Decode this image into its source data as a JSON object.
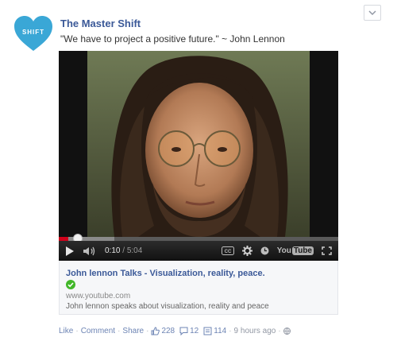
{
  "post": {
    "page_name": "The Master Shift",
    "avatar_text": "SHIFT",
    "message": "\"We have to project a positive future.\" ~ John Lennon"
  },
  "video": {
    "current_time": "0:10",
    "duration": "5:04",
    "progress_fraction": 0.033,
    "buffered_fraction": 0.2,
    "youtube_logo_you": "You",
    "youtube_logo_tube": "Tube"
  },
  "link": {
    "title": "John lennon Talks - Visualization, reality, peace.",
    "domain": "www.youtube.com",
    "description": "John lennon speaks about visualization, reality and peace"
  },
  "actions": {
    "like": "Like",
    "comment": "Comment",
    "share": "Share",
    "like_count": "228",
    "comment_count": "12",
    "share_count": "114",
    "timestamp": "9 hours ago"
  },
  "colors": {
    "link_blue": "#3b5998",
    "avatar_blue": "#3aa7d6",
    "verified_green": "#42b72a"
  }
}
